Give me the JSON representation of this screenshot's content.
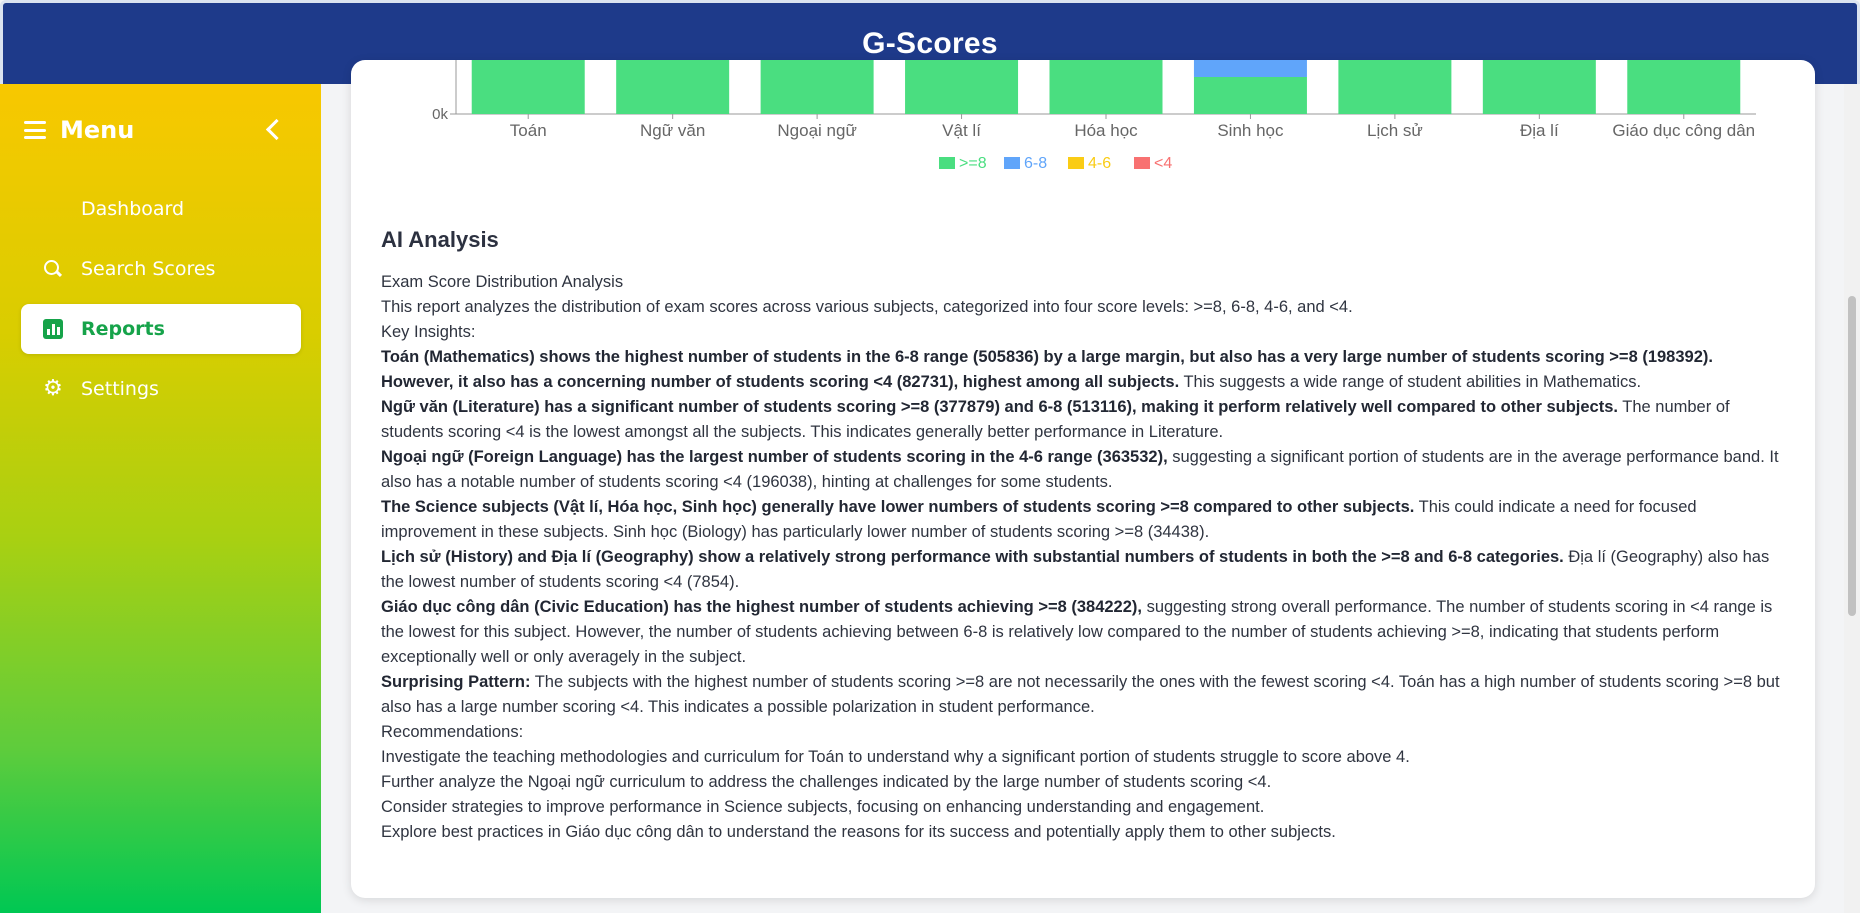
{
  "app": {
    "title": "G-Scores"
  },
  "sidebar": {
    "menu_label": "Menu",
    "items": [
      {
        "label": "Dashboard",
        "icon": "dashboard-icon",
        "active": false
      },
      {
        "label": "Search Scores",
        "icon": "search-icon",
        "active": false
      },
      {
        "label": "Reports",
        "icon": "bar-chart-icon",
        "active": true
      },
      {
        "label": "Settings",
        "icon": "gear-icon",
        "active": false
      }
    ]
  },
  "chart_data": {
    "type": "bar",
    "stacked": true,
    "categories": [
      "Toán",
      "Ngữ văn",
      "Ngoại ngữ",
      "Vật lí",
      "Hóa học",
      "Sinh học",
      "Lịch sử",
      "Địa lí",
      "Giáo dục công dân"
    ],
    "y_tick_visible": "0k",
    "series": [
      {
        "name": ">=8",
        "color": "#4ade80"
      },
      {
        "name": "6-8",
        "color": "#60a5fa"
      },
      {
        "name": "4-6",
        "color": "#facc15"
      },
      {
        "name": "<4",
        "color": "#f87171"
      }
    ],
    "legend": "bottom"
  },
  "analysis": {
    "title": "AI Analysis",
    "lines": [
      {
        "plain": "Exam Score Distribution Analysis"
      },
      {
        "plain": "This report analyzes the distribution of exam scores across various subjects, categorized into four score levels: >=8, 6-8, 4-6, and <4."
      },
      {
        "plain": "Key Insights:"
      },
      {
        "bold": "Toán (Mathematics) shows the highest number of students in the 6-8 range (505836) by a large margin, but also has a very large number of students scoring >=8 (198392). However, it also has a concerning number of students scoring <4 (82731), highest among all subjects.",
        "plain": " This suggests a wide range of student abilities in Mathematics."
      },
      {
        "bold": "Ngữ văn (Literature) has a significant number of students scoring >=8 (377879) and 6-8 (513116), making it perform relatively well compared to other subjects.",
        "plain": " The number of students scoring <4 is the lowest amongst all the subjects. This indicates generally better performance in Literature."
      },
      {
        "bold": "Ngoại ngữ (Foreign Language) has the largest number of students scoring in the 4-6 range (363532),",
        "plain": " suggesting a significant portion of students are in the average performance band. It also has a notable number of students scoring <4 (196038), hinting at challenges for some students."
      },
      {
        "bold": "The Science subjects (Vật lí, Hóa học, Sinh học) generally have lower numbers of students scoring >=8 compared to other subjects.",
        "plain": " This could indicate a need for focused improvement in these subjects. Sinh học (Biology) has particularly lower number of students scoring >=8 (34438)."
      },
      {
        "bold": "Lịch sử (History) and Địa lí (Geography) show a relatively strong performance with substantial numbers of students in both the >=8 and 6-8 categories.",
        "plain": " Địa lí (Geography) also has the lowest number of students scoring <4 (7854)."
      },
      {
        "bold": "Giáo dục công dân (Civic Education) has the highest number of students achieving >=8 (384222),",
        "plain": " suggesting strong overall performance. The number of students scoring in <4 range is the lowest for this subject. However, the number of students achieving between 6-8 is relatively low compared to the number of students achieving >=8, indicating that students perform exceptionally well or only averagely in the subject."
      },
      {
        "bold": "Surprising Pattern:",
        "plain": " The subjects with the highest number of students scoring >=8 are not necessarily the ones with the fewest scoring <4. Toán has a high number of students scoring >=8 but also has a large number scoring <4. This indicates a possible polarization in student performance."
      },
      {
        "plain": "Recommendations:"
      },
      {
        "plain": "Investigate the teaching methodologies and curriculum for Toán to understand why a significant portion of students struggle to score above 4."
      },
      {
        "plain": "Further analyze the Ngoại ngữ curriculum to address the challenges indicated by the large number of students scoring <4."
      },
      {
        "plain": "Consider strategies to improve performance in Science subjects, focusing on enhancing understanding and engagement."
      },
      {
        "plain": "Explore best practices in Giáo dục công dân to understand the reasons for its success and potentially apply them to other subjects."
      }
    ]
  }
}
